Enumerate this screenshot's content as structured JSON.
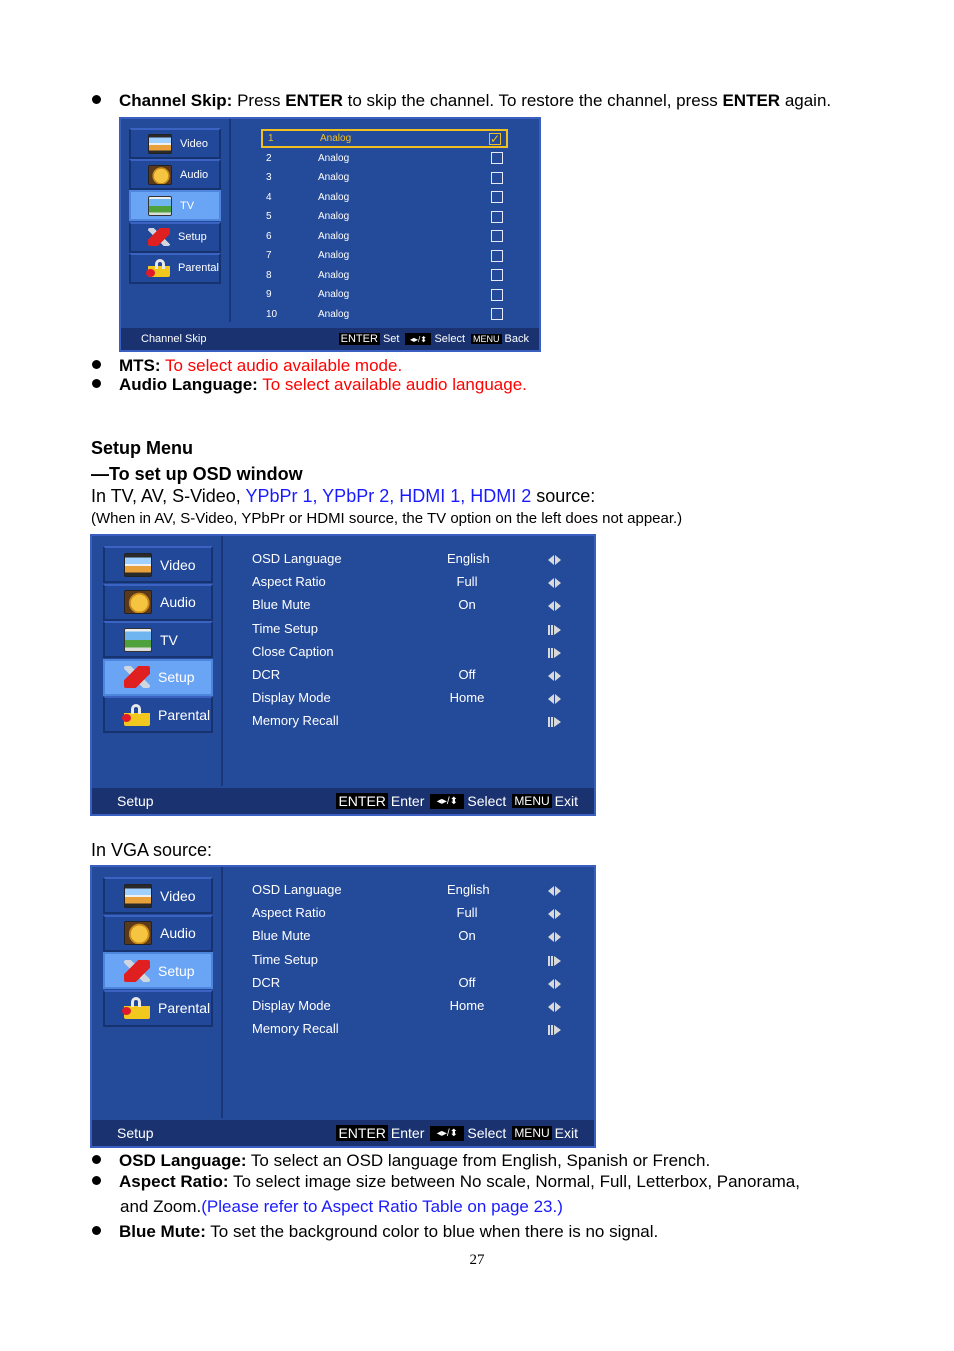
{
  "page_number": "27",
  "channel_skip_bullet": {
    "term": "Channel Skip:",
    "text_1": " Press ",
    "enter_1": "ENTER",
    "text_2": " to skip the channel. To restore the channel, press ",
    "enter_2": "ENTER",
    "text_3": " again."
  },
  "channel_skip_osd": {
    "sidebar": [
      {
        "label": "Video",
        "icon": "video-icon",
        "active": false
      },
      {
        "label": "Audio",
        "icon": "audio-icon",
        "active": false
      },
      {
        "label": "TV",
        "icon": "tv-icon",
        "active": true
      },
      {
        "label": "Setup",
        "icon": "setup-icon",
        "active": false
      },
      {
        "label": "Parental",
        "icon": "parental-lock-icon",
        "active": false
      }
    ],
    "channels": [
      {
        "number": "1",
        "type": "Analog",
        "skipped": true,
        "selected": true
      },
      {
        "number": "2",
        "type": "Analog",
        "skipped": false,
        "selected": false
      },
      {
        "number": "3",
        "type": "Analog",
        "skipped": false,
        "selected": false
      },
      {
        "number": "4",
        "type": "Analog",
        "skipped": false,
        "selected": false
      },
      {
        "number": "5",
        "type": "Analog",
        "skipped": false,
        "selected": false
      },
      {
        "number": "6",
        "type": "Analog",
        "skipped": false,
        "selected": false
      },
      {
        "number": "7",
        "type": "Analog",
        "skipped": false,
        "selected": false
      },
      {
        "number": "8",
        "type": "Analog",
        "skipped": false,
        "selected": false
      },
      {
        "number": "9",
        "type": "Analog",
        "skipped": false,
        "selected": false
      },
      {
        "number": "10",
        "type": "Analog",
        "skipped": false,
        "selected": false
      }
    ],
    "checkmark": "✓",
    "footer": {
      "title": "Channel Skip",
      "key_enter": "ENTER",
      "enter_action": "Set",
      "select_action": "Select",
      "key_menu": "MENU",
      "menu_action": "Back"
    }
  },
  "mts_bullet": {
    "term": "MTS:",
    "text": " To select audio available mode."
  },
  "audio_language_bullet": {
    "term": "Audio Language:",
    "text": " To select available audio language."
  },
  "setup_section": {
    "heading": "Setup Menu",
    "subheading": "—To set up OSD window",
    "source_line_prefix": "In TV, AV, S-Video, ",
    "source_line_highlight": "YPbPr 1, YPbPr 2, HDMI 1, HDMI 2",
    "source_line_suffix": " source:",
    "note": "(When in AV, S-Video, YPbPr or HDMI source, the TV option on the left does not appear.)"
  },
  "setup_osd_tv": {
    "sidebar": [
      {
        "label": "Video",
        "active": false
      },
      {
        "label": "Audio",
        "active": false
      },
      {
        "label": "TV",
        "active": false
      },
      {
        "label": "Setup",
        "active": true
      },
      {
        "label": "Parental",
        "active": false
      }
    ],
    "rows": [
      {
        "label": "OSD Language",
        "value": "English",
        "arrow": "left-right"
      },
      {
        "label": "Aspect Ratio",
        "value": "Full",
        "arrow": "left-right"
      },
      {
        "label": "Blue Mute",
        "value": "On",
        "arrow": "left-right"
      },
      {
        "label": "Time Setup",
        "value": "",
        "arrow": "submenu"
      },
      {
        "label": "Close Caption",
        "value": "",
        "arrow": "submenu"
      },
      {
        "label": "DCR",
        "value": "Off",
        "arrow": "left-right"
      },
      {
        "label": "Display Mode",
        "value": "Home",
        "arrow": "left-right"
      },
      {
        "label": "Memory Recall",
        "value": "",
        "arrow": "submenu"
      }
    ],
    "footer": {
      "title": "Setup",
      "key_enter": "ENTER",
      "enter_action": "Enter",
      "select_action": "Select",
      "key_menu": "MENU",
      "menu_action": "Exit"
    }
  },
  "vga_caption": "In VGA source:",
  "setup_osd_vga": {
    "sidebar": [
      {
        "label": "Video",
        "active": false
      },
      {
        "label": "Audio",
        "active": false
      },
      {
        "label": "Setup",
        "active": true
      },
      {
        "label": "Parental",
        "active": false
      }
    ],
    "rows": [
      {
        "label": "OSD Language",
        "value": "English",
        "arrow": "left-right"
      },
      {
        "label": "Aspect Ratio",
        "value": "Full",
        "arrow": "left-right"
      },
      {
        "label": "Blue Mute",
        "value": "On",
        "arrow": "left-right"
      },
      {
        "label": "Time Setup",
        "value": "",
        "arrow": "submenu"
      },
      {
        "label": "DCR",
        "value": "Off",
        "arrow": "left-right"
      },
      {
        "label": "Display Mode",
        "value": "Home",
        "arrow": "left-right"
      },
      {
        "label": "Memory Recall",
        "value": "",
        "arrow": "submenu"
      }
    ],
    "footer": {
      "title": "Setup",
      "key_enter": "ENTER",
      "enter_action": "Enter",
      "select_action": "Select",
      "key_menu": "MENU",
      "menu_action": "Exit"
    }
  },
  "osd_language_bullet": {
    "term": "OSD Language:",
    "text": " To select an OSD language from English, Spanish or French."
  },
  "aspect_ratio_bullet": {
    "term": "Aspect Ratio:",
    "text": " To select image size between No scale, Normal, Full, Letterbox, Panorama,",
    "text_cont": "and Zoom.",
    "link": "(Please refer to Aspect Ratio Table on page 23.)"
  },
  "blue_mute_bullet": {
    "term": "Blue Mute:",
    "text": " To set the background color to blue when there is no signal."
  },
  "colors": {
    "osd_bg": "#244a9a",
    "osd_active": "#6aa4f4",
    "osd_footer": "#1a3270",
    "highlight_yellow": "#f0c020",
    "red_text": "#ff0000",
    "blue_text": "#1a1aff"
  }
}
